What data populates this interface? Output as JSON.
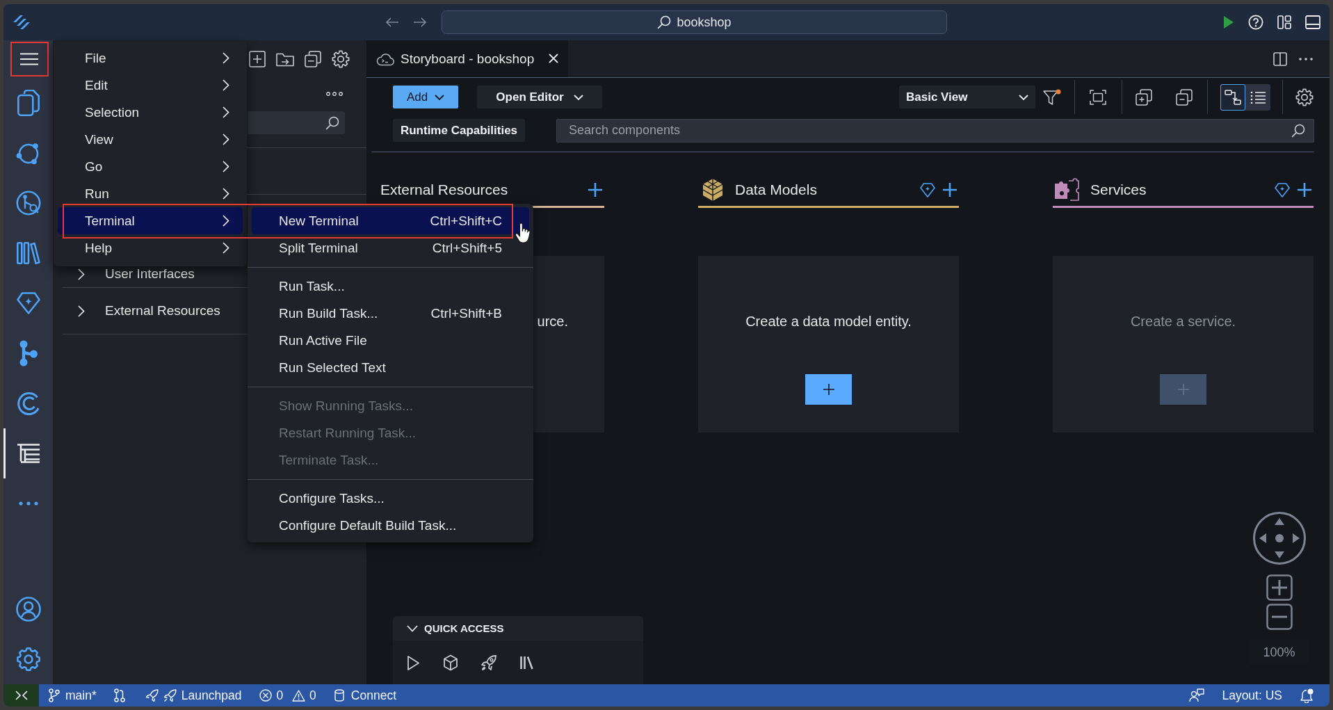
{
  "title_bar": {
    "command_center": "bookshop"
  },
  "activity_bar": {
    "menu_button": {
      "outlined": true
    },
    "items": [
      {
        "selected": false
      },
      {
        "selected": false
      },
      {
        "selected": false
      },
      {
        "selected": false
      },
      {
        "selected": false
      },
      {
        "selected": false
      },
      {
        "selected": false
      },
      {
        "selected": true
      },
      {
        "selected": false
      }
    ]
  },
  "side_panel": {
    "sections": [
      {
        "label": "User Interfaces",
        "expanded": false
      },
      {
        "label": "External Resources",
        "expanded": false
      }
    ]
  },
  "main_menu": {
    "items": [
      {
        "label": "File",
        "submenu": true,
        "selected": false,
        "outlined": false
      },
      {
        "label": "Edit",
        "submenu": true,
        "selected": false,
        "outlined": false
      },
      {
        "label": "Selection",
        "submenu": true,
        "selected": false,
        "outlined": false
      },
      {
        "label": "View",
        "submenu": true,
        "selected": false,
        "outlined": false
      },
      {
        "label": "Go",
        "submenu": true,
        "selected": false,
        "outlined": false
      },
      {
        "label": "Run",
        "submenu": true,
        "selected": false,
        "outlined": false
      },
      {
        "label": "Terminal",
        "submenu": true,
        "selected": true,
        "outlined": true
      },
      {
        "label": "Help",
        "submenu": true,
        "selected": false,
        "outlined": false
      }
    ]
  },
  "submenu": {
    "items": [
      {
        "kind": "item",
        "label": "New Terminal",
        "shortcut": "Ctrl+Shift+C",
        "selected": true,
        "disabled": false
      },
      {
        "kind": "item",
        "label": "Split Terminal",
        "shortcut": "Ctrl+Shift+5",
        "selected": false,
        "disabled": false
      },
      {
        "kind": "separator"
      },
      {
        "kind": "item",
        "label": "Run Task...",
        "selected": false,
        "disabled": false
      },
      {
        "kind": "item",
        "label": "Run Build Task...",
        "shortcut": "Ctrl+Shift+B",
        "selected": false,
        "disabled": false
      },
      {
        "kind": "item",
        "label": "Run Active File",
        "selected": false,
        "disabled": false
      },
      {
        "kind": "item",
        "label": "Run Selected Text",
        "selected": false,
        "disabled": false
      },
      {
        "kind": "separator"
      },
      {
        "kind": "item",
        "label": "Show Running Tasks...",
        "selected": false,
        "disabled": true
      },
      {
        "kind": "item",
        "label": "Restart Running Task...",
        "selected": false,
        "disabled": true
      },
      {
        "kind": "item",
        "label": "Terminate Task...",
        "selected": false,
        "disabled": true
      },
      {
        "kind": "separator"
      },
      {
        "kind": "item",
        "label": "Configure Tasks...",
        "selected": false,
        "disabled": false
      },
      {
        "kind": "item",
        "label": "Configure Default Build Task...",
        "selected": false,
        "disabled": false
      }
    ]
  },
  "editor": {
    "tabs": [
      {
        "label": "Storyboard - bookshop",
        "selected": true
      }
    ],
    "toolbar": {
      "add_button": "Add",
      "open_editor_button": "Open Editor",
      "view_select": "Basic View",
      "filter_active": true,
      "view_modes": [
        {
          "selected": true
        },
        {
          "selected": false
        }
      ],
      "runtime_button": "Runtime Capabilities",
      "search": {
        "placeholder": "Search components"
      }
    },
    "columns": [
      {
        "kind": "resource",
        "title": "External Resources",
        "color": "#d4b398",
        "premium": false,
        "card": {
          "text": "urce."
        }
      },
      {
        "kind": "data_model",
        "title": "Data Models",
        "color": "#c9ad62",
        "premium": true,
        "card": {
          "text": "Create a data model entity.",
          "enabled": true
        }
      },
      {
        "kind": "service",
        "title": "Services",
        "color": "#c08ab9",
        "premium": true,
        "card": {
          "text": "Create a service.",
          "enabled": false
        }
      }
    ],
    "zoom_level": "100%",
    "quick_access": {
      "title": "QUICK ACCESS",
      "expanded": true
    }
  },
  "status_bar": {
    "branch": "main*",
    "launchpad": "Launchpad",
    "errors": "0",
    "warnings": "0",
    "connect": "Connect",
    "layout": "Layout: US",
    "notification_unread": true
  }
}
